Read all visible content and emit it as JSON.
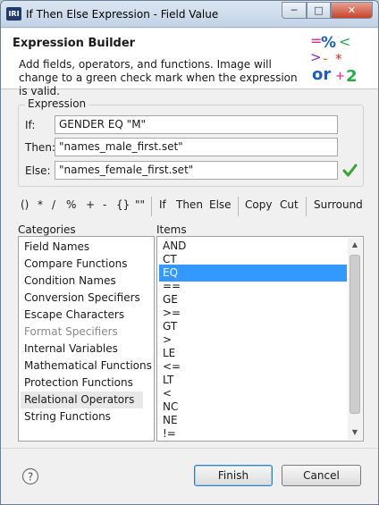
{
  "window": {
    "title": "If Then Else Expression - Field Value",
    "app_icon_text": "IRI",
    "controls": [
      "minimize-icon",
      "maximize-icon",
      "close-icon"
    ]
  },
  "header": {
    "title": "Expression Builder",
    "description": "Add fields, operators, and functions. Image will change to a green check mark when the expression is valid.",
    "art_icon": "expression-builder-art"
  },
  "expression": {
    "group_label": "Expression",
    "if": {
      "label": "If:",
      "value": "GENDER EQ \"M\""
    },
    "then": {
      "label": "Then:",
      "value": "\"names_male_first.set\""
    },
    "else": {
      "label": "Else:",
      "value": "\"names_female_first.set\""
    },
    "status_icon": "valid-checkmark-icon",
    "status_color": "#3aa335"
  },
  "toolbar": {
    "operators": [
      "()",
      "*",
      "/",
      "%",
      "+",
      "-",
      "{}",
      "\"\""
    ],
    "keywords": [
      "If",
      "Then",
      "Else"
    ],
    "edit": [
      "Copy",
      "Cut"
    ],
    "surround": "Surround"
  },
  "categories": {
    "label": "Categories",
    "items": [
      {
        "label": "Field Names",
        "enabled": true
      },
      {
        "label": "Compare Functions",
        "enabled": true
      },
      {
        "label": "Condition Names",
        "enabled": true
      },
      {
        "label": "Conversion Specifiers",
        "enabled": true
      },
      {
        "label": "Escape Characters",
        "enabled": true
      },
      {
        "label": "Format Specifiers",
        "enabled": false
      },
      {
        "label": "Internal Variables",
        "enabled": true
      },
      {
        "label": "Mathematical Functions",
        "enabled": true
      },
      {
        "label": "Protection Functions",
        "enabled": true
      },
      {
        "label": "Relational Operators",
        "enabled": true,
        "selected": true
      },
      {
        "label": "String Functions",
        "enabled": true
      }
    ]
  },
  "items": {
    "label": "Items",
    "values": [
      "AND",
      "CT",
      "EQ",
      "==",
      "GE",
      ">=",
      "GT",
      ">",
      "LE",
      "<=",
      "LT",
      "<",
      "NC",
      "NE",
      "!="
    ],
    "selected": "EQ",
    "selection_color": "#3399ff"
  },
  "footer": {
    "help_icon": "help-icon",
    "finish_label": "Finish",
    "cancel_label": "Cancel"
  }
}
